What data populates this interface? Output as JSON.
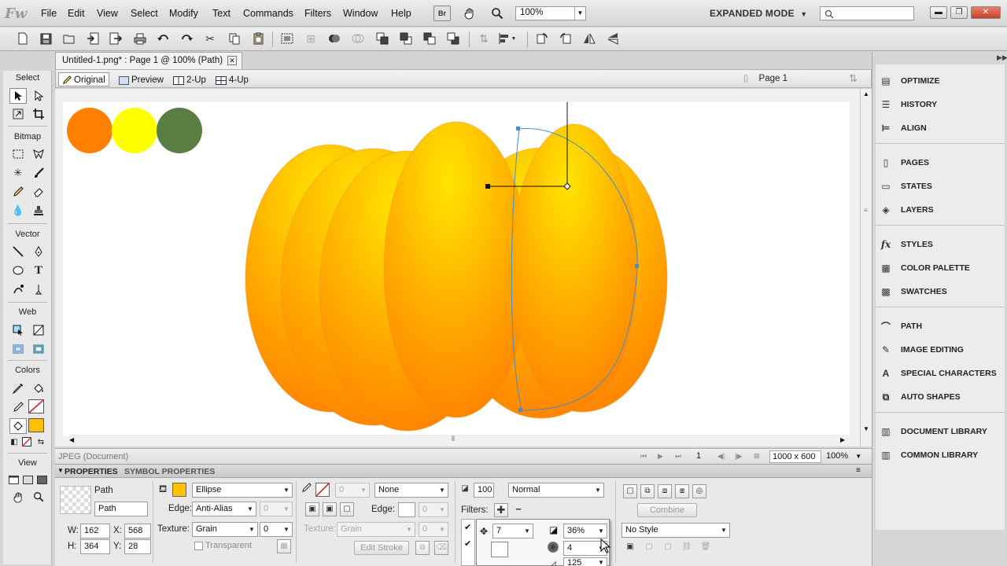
{
  "app": {
    "logo": "Fw",
    "menu": [
      "File",
      "Edit",
      "View",
      "Select",
      "Modify",
      "Text",
      "Commands",
      "Filters",
      "Window",
      "Help"
    ],
    "bridge_label": "Br",
    "zoom": "100%",
    "workspace_mode": "EXPANDED MODE"
  },
  "document": {
    "tab_title": "Untitled-1.png* : Page 1 @ 100% (Path)",
    "views": [
      "Original",
      "Preview",
      "2-Up",
      "4-Up"
    ],
    "active_view": "Original",
    "page": "Page 1",
    "status_type": "JPEG (Document)",
    "page_number": "1",
    "canvas_size": "1000 x 600",
    "status_zoom": "100%"
  },
  "tools": {
    "sections": [
      "Select",
      "Bitmap",
      "Vector",
      "Web",
      "Colors",
      "View"
    ]
  },
  "colors": {
    "circles": [
      "#ff7f00",
      "#ffff00",
      "#5a7d44"
    ],
    "fill": "#ffc000",
    "pumpkin_light": "#ffe500",
    "pumpkin_dark": "#ff7a00",
    "selection": "#3a8fd6"
  },
  "properties": {
    "tabs": [
      "PROPERTIES",
      "SYMBOL PROPERTIES"
    ],
    "object_type": "Path",
    "object_name": "Path",
    "w": "162",
    "h": "364",
    "x": "568",
    "y": "28",
    "fill_type": "Ellipse",
    "edge_label": "Edge:",
    "edge": "Anti-Alias",
    "edge_value": "0",
    "texture_label": "Texture:",
    "texture": "Grain",
    "texture_value": "0",
    "transparent_label": "Transparent",
    "stroke_size": "0",
    "stroke_type": "None",
    "stroke_edge_label": "Edge:",
    "stroke_edge_value": "0",
    "stroke_texture_label": "Texture:",
    "stroke_texture": "Grain",
    "stroke_texture_value": "0",
    "edit_stroke": "Edit Stroke",
    "opacity": "100",
    "blend_mode": "Normal",
    "filters_label": "Filters:",
    "filter_distance": "7",
    "filter_opacity": "36%",
    "filter_softness": "4",
    "filter_angle": "125",
    "combine": "Combine",
    "style": "No Style"
  },
  "right_panels": {
    "group1": [
      "OPTIMIZE",
      "HISTORY",
      "ALIGN"
    ],
    "group2": [
      "PAGES",
      "STATES",
      "LAYERS"
    ],
    "group3": [
      "STYLES",
      "COLOR PALETTE",
      "SWATCHES"
    ],
    "group4": [
      "PATH",
      "IMAGE EDITING",
      "SPECIAL CHARACTERS",
      "AUTO SHAPES"
    ],
    "group5": [
      "DOCUMENT LIBRARY",
      "COMMON LIBRARY"
    ]
  }
}
